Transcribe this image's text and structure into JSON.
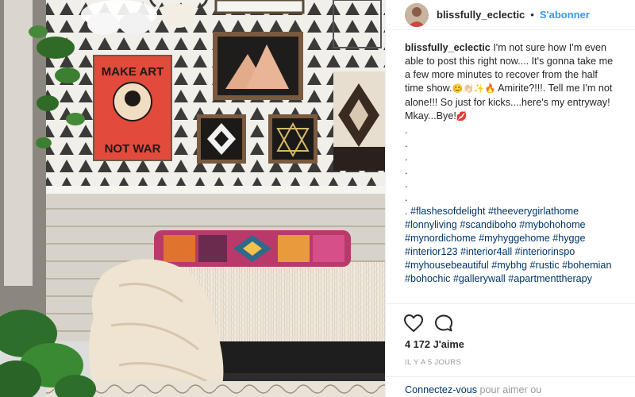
{
  "post": {
    "username": "blissfully_eclectic",
    "separator": "•",
    "follow_label": "S'abonner",
    "caption_text_1": "I'm not sure how I'm even able to post this right now.... It's gonna take me a few more minutes to recover from the half time show.",
    "caption_emoji_1": "😊👏🏻✨🔥",
    "caption_text_2": " Amirite?!!!. Tell me I'm not alone!!! So just for kicks....here's my entryway! Mkay...Bye!",
    "caption_emoji_2": "💋",
    "dots": [
      ".",
      ".",
      ".",
      ".",
      ".",
      "."
    ],
    "tags_prefix": ". ",
    "hashtags": [
      "#flashesofdelight",
      "#theeverygirlathome",
      "#lonnyliving",
      "#scandiboho",
      "#mybohohome",
      "#mynordichome",
      "#myhyggehome",
      "#hygge",
      "#interior123",
      "#interior4all",
      "#interiorinspo",
      "#myhousebeautiful",
      "#mybhg",
      "#rustic",
      "#bohemian",
      "#bohochic",
      "#gallerywall",
      "#apartmenttherapy"
    ],
    "likes": "4 172 J'aime",
    "time_ago": "IL Y A 5 JOURS",
    "login_link": "Connectez-vous",
    "login_rest": " pour aimer ou"
  },
  "icons": {
    "like": "heart-icon",
    "comment": "comment-bubble-icon"
  },
  "artwork": {
    "poster_line_1": "MAKE ART",
    "poster_line_2": "NOT WAR"
  },
  "colors": {
    "follow": "#3897f0",
    "hashtag": "#003569",
    "muted": "#999999",
    "text": "#262626"
  }
}
